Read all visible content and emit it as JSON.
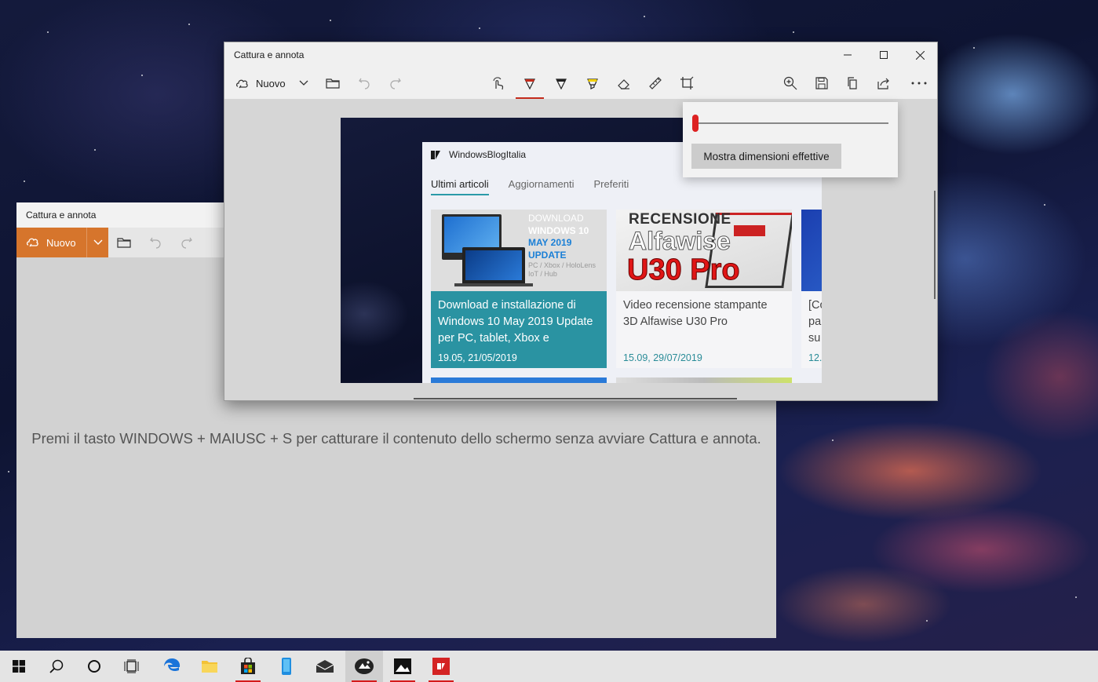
{
  "desktop": {
    "taskbar": {
      "items": [
        {
          "name": "start-button",
          "icon": "windows-logo-icon"
        },
        {
          "name": "search-button",
          "icon": "search-icon"
        },
        {
          "name": "cortana-button",
          "icon": "circle-icon"
        },
        {
          "name": "task-view-button",
          "icon": "task-view-icon"
        },
        {
          "name": "edge-app",
          "icon": "edge-icon"
        },
        {
          "name": "file-explorer-app",
          "icon": "folder-icon"
        },
        {
          "name": "store-app",
          "icon": "store-bag-icon",
          "running": true
        },
        {
          "name": "phone-app",
          "icon": "phone-icon"
        },
        {
          "name": "mail-app",
          "icon": "mail-icon"
        },
        {
          "name": "snip-sketch-app",
          "icon": "snip-sketch-icon",
          "running": true,
          "active": true
        },
        {
          "name": "photos-app",
          "icon": "photos-icon",
          "running": true
        },
        {
          "name": "blog-app",
          "icon": "blog-app-icon",
          "running": true
        }
      ]
    }
  },
  "back_window": {
    "title": "Cattura e annota",
    "toolbar": {
      "new_label": "Nuovo"
    },
    "hint": "Premi il tasto WINDOWS + MAIUSC + S per catturare il contenuto dello schermo senza avviare Cattura e annota.",
    "accent": "#d6752c"
  },
  "front_window": {
    "title": "Cattura e annota",
    "toolbar": {
      "new_label": "Nuovo",
      "tools": [
        "touch-writing-icon",
        "ballpoint-pen-icon",
        "pencil-icon",
        "highlighter-icon",
        "eraser-icon",
        "ruler-icon",
        "crop-icon"
      ],
      "active_tool": "ballpoint-pen-icon",
      "right_tools": [
        "zoom-icon",
        "save-icon",
        "copy-icon",
        "share-icon",
        "more-icon"
      ],
      "pen_color": "#c42b1c"
    },
    "zoom_popup": {
      "actual_size_label": "Mostra dimensioni effettive",
      "zoom_level": 0
    },
    "capture": {
      "app_title": "WindowsBlogItalia",
      "tabs": [
        "Ultimi articoli",
        "Aggiornamenti",
        "Preferiti"
      ],
      "active_tab": "Ultimi articoli",
      "cards": [
        {
          "thumb_lines": [
            "DOWNLOAD",
            "WINDOWS 10",
            "MAY 2019",
            "UPDATE"
          ],
          "thumb_sub": "PC / Xbox / HoloLens IoT / Hub",
          "headline": "Download e installazione di Windows 10 May 2019 Update per PC, tablet, Xbox e",
          "date": "19.05, 21/05/2019"
        },
        {
          "thumb_lines": [
            "RECENSIONE",
            "Alfawise",
            "U30 Pro"
          ],
          "headline": "Video recensione stampante 3D Alfawise U30 Pro",
          "date": "15.09, 29/07/2019"
        },
        {
          "headline": "[Co pa su",
          "date": "12."
        }
      ]
    }
  }
}
